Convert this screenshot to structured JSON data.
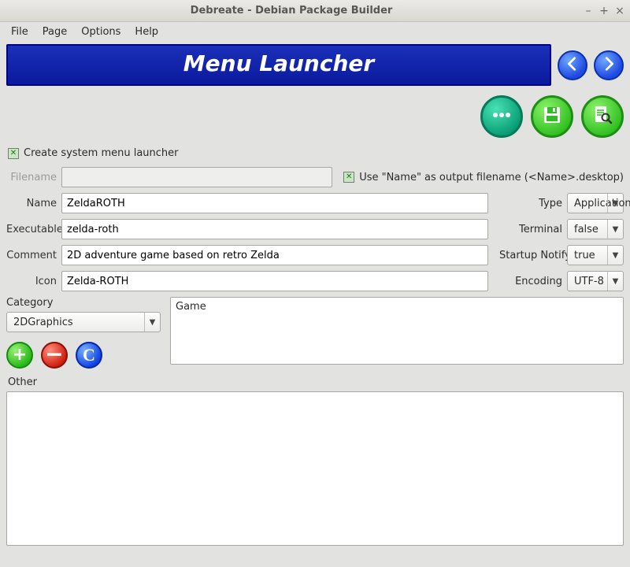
{
  "window": {
    "title": "Debreate - Debian Package Builder"
  },
  "menubar": {
    "file": "File",
    "page": "Page",
    "options": "Options",
    "help": "Help"
  },
  "banner": {
    "title": "Menu Launcher"
  },
  "checks": {
    "create_launcher": "Create system menu launcher",
    "use_name_as_filename": "Use \"Name\" as output filename (<Name>.desktop)"
  },
  "labels": {
    "filename": "Filename",
    "name": "Name",
    "executable": "Executable",
    "comment": "Comment",
    "icon": "Icon",
    "type": "Type",
    "terminal": "Terminal",
    "startup_notify": "Startup Notify",
    "encoding": "Encoding",
    "category": "Category",
    "other": "Other"
  },
  "fields": {
    "filename": "",
    "name": "ZeldaROTH",
    "executable": "zelda-roth",
    "comment": "2D adventure game based on retro Zelda",
    "icon": "Zelda-ROTH",
    "type": "Application",
    "terminal": "false",
    "startup_notify": "true",
    "encoding": "UTF-8",
    "category_selected": "2DGraphics",
    "category_list_first": "Game"
  }
}
